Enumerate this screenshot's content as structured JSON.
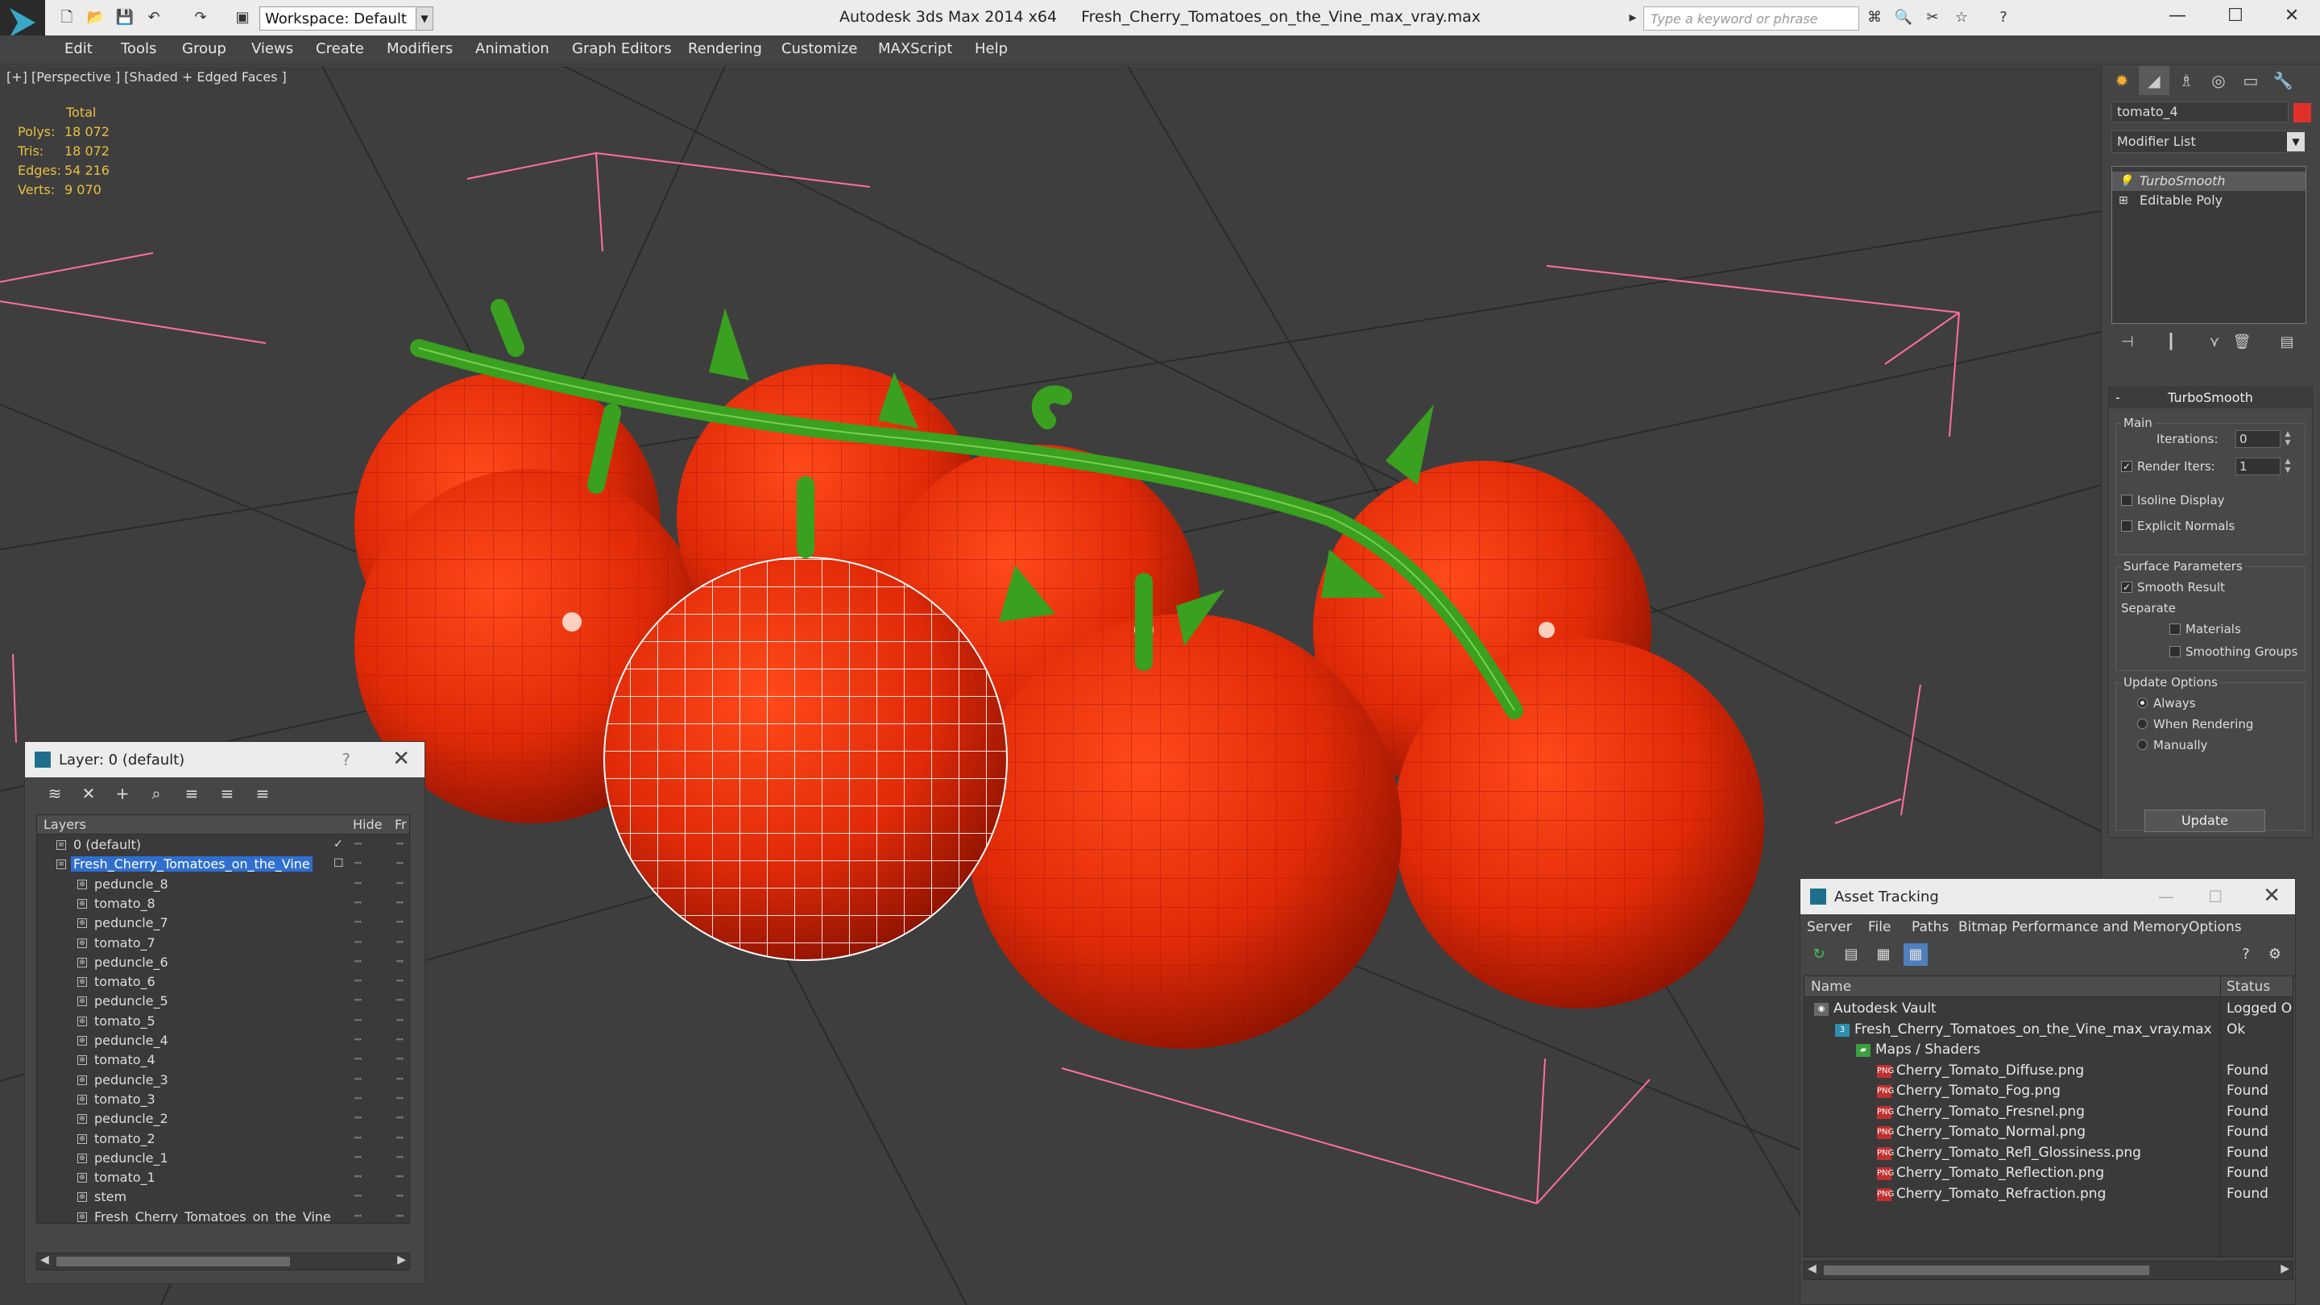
{
  "app": {
    "title": "Autodesk 3ds Max  2014 x64",
    "file": "Fresh_Cherry_Tomatoes_on_the_Vine_max_vray.max",
    "workspace": "Workspace: Default",
    "search_placeholder": "Type a keyword or phrase"
  },
  "menu": [
    "Edit",
    "Tools",
    "Group",
    "Views",
    "Create",
    "Modifiers",
    "Animation",
    "Graph Editors",
    "Rendering",
    "Customize",
    "MAXScript",
    "Help"
  ],
  "viewport": {
    "label": "[+] [Perspective ] [Shaded + Edged Faces ]",
    "stats": {
      "header": "Total",
      "polys_label": "Polys:",
      "polys": "18 072",
      "tris_label": "Tris:",
      "tris": "18 072",
      "edges_label": "Edges:",
      "edges": "54 216",
      "verts_label": "Verts:",
      "verts": "9 070"
    }
  },
  "command_panel": {
    "object_name": "tomato_4",
    "object_color": "#e0302a",
    "modifier_list": "Modifier List",
    "stack": [
      "TurboSmooth",
      "Editable Poly"
    ],
    "turbosmooth": {
      "title": "TurboSmooth",
      "main": "Main",
      "iterations_label": "Iterations:",
      "iterations": "0",
      "render_iters_label": "Render Iters:",
      "render_iters": "1",
      "render_iters_checked": true,
      "isoline": "Isoline Display",
      "explicit_normals": "Explicit Normals",
      "surface_params": "Surface Parameters",
      "smooth_result": "Smooth Result",
      "separate": "Separate",
      "materials": "Materials",
      "smoothing_groups": "Smoothing Groups",
      "update_options": "Update Options",
      "always": "Always",
      "when_rendering": "When Rendering",
      "manually": "Manually",
      "update": "Update"
    }
  },
  "layer_dialog": {
    "title": "Layer: 0 (default)",
    "help": "?",
    "col_layers": "Layers",
    "col_hide": "Hide",
    "col_freeze": "Fr",
    "rows": [
      {
        "name": "0 (default)",
        "indent": 1,
        "kind": "layer"
      },
      {
        "name": "Fresh_Cherry_Tomatoes_on_the_Vine",
        "indent": 1,
        "kind": "layer",
        "selected": true
      },
      {
        "name": "peduncle_8",
        "indent": 2,
        "kind": "obj"
      },
      {
        "name": "tomato_8",
        "indent": 2,
        "kind": "obj"
      },
      {
        "name": "peduncle_7",
        "indent": 2,
        "kind": "obj"
      },
      {
        "name": "tomato_7",
        "indent": 2,
        "kind": "obj"
      },
      {
        "name": "peduncle_6",
        "indent": 2,
        "kind": "obj"
      },
      {
        "name": "tomato_6",
        "indent": 2,
        "kind": "obj"
      },
      {
        "name": "peduncle_5",
        "indent": 2,
        "kind": "obj"
      },
      {
        "name": "tomato_5",
        "indent": 2,
        "kind": "obj"
      },
      {
        "name": "peduncle_4",
        "indent": 2,
        "kind": "obj"
      },
      {
        "name": "tomato_4",
        "indent": 2,
        "kind": "obj"
      },
      {
        "name": "peduncle_3",
        "indent": 2,
        "kind": "obj"
      },
      {
        "name": "tomato_3",
        "indent": 2,
        "kind": "obj"
      },
      {
        "name": "peduncle_2",
        "indent": 2,
        "kind": "obj"
      },
      {
        "name": "tomato_2",
        "indent": 2,
        "kind": "obj"
      },
      {
        "name": "peduncle_1",
        "indent": 2,
        "kind": "obj"
      },
      {
        "name": "tomato_1",
        "indent": 2,
        "kind": "obj"
      },
      {
        "name": "stem",
        "indent": 2,
        "kind": "obj"
      },
      {
        "name": "Fresh_Cherry_Tomatoes_on_the_Vine",
        "indent": 2,
        "kind": "obj"
      }
    ]
  },
  "asset_dialog": {
    "title": "Asset Tracking",
    "menu": [
      "Server",
      "File",
      "Paths",
      "Bitmap Performance and Memory",
      "Options"
    ],
    "col_name": "Name",
    "col_status": "Status",
    "rows": [
      {
        "name": "Autodesk Vault",
        "status": "Logged Out",
        "indent": 0,
        "icon": "vault"
      },
      {
        "name": "Fresh_Cherry_Tomatoes_on_the_Vine_max_vray.max",
        "status": "Ok",
        "indent": 1,
        "icon": "max"
      },
      {
        "name": "Maps / Shaders",
        "status": "",
        "indent": 2,
        "icon": "maps"
      },
      {
        "name": "Cherry_Tomato_Diffuse.png",
        "status": "Found",
        "indent": 3,
        "icon": "png"
      },
      {
        "name": "Cherry_Tomato_Fog.png",
        "status": "Found",
        "indent": 3,
        "icon": "png"
      },
      {
        "name": "Cherry_Tomato_Fresnel.png",
        "status": "Found",
        "indent": 3,
        "icon": "png"
      },
      {
        "name": "Cherry_Tomato_Normal.png",
        "status": "Found",
        "indent": 3,
        "icon": "png"
      },
      {
        "name": "Cherry_Tomato_Refl_Glossiness.png",
        "status": "Found",
        "indent": 3,
        "icon": "png"
      },
      {
        "name": "Cherry_Tomato_Reflection.png",
        "status": "Found",
        "indent": 3,
        "icon": "png"
      },
      {
        "name": "Cherry_Tomato_Refraction.png",
        "status": "Found",
        "indent": 3,
        "icon": "png"
      }
    ]
  }
}
